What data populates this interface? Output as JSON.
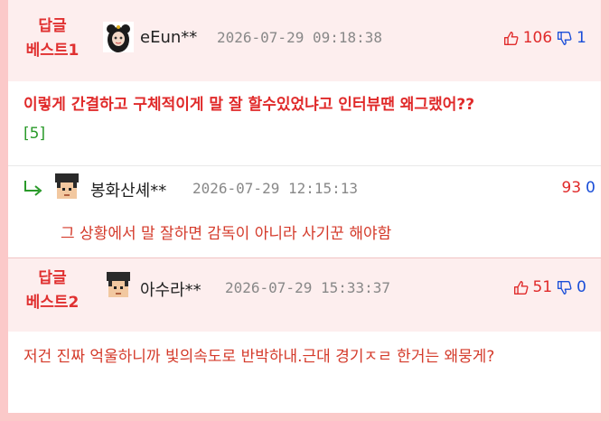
{
  "comments": [
    {
      "badge_line1": "답글",
      "badge_line2": "베스트1",
      "nickname": "eEun**",
      "date": "2026-07-29 09:18:38",
      "up": "106",
      "down": "1",
      "text": "이렇게 간결하고 구체적이게 말 잘 할수있었냐고 인터뷰땐 왜그랬어??",
      "reply_count": "[5]"
    },
    {
      "badge_line1": "답글",
      "badge_line2": "베스트2",
      "nickname": "아수라**",
      "date": "2026-07-29 15:33:37",
      "up": "51",
      "down": "0",
      "text": "저건 진짜 억울하니까 빛의속도로 반박하내.근대 경기ㅈㄹ 한거는 왜뭉게?"
    }
  ],
  "reply": {
    "nickname": "봉화산셰**",
    "date": "2026-07-29 12:15:13",
    "up": "93",
    "down": "0",
    "text": "그 상황에서 말 잘하면 감독이 아니라 사기꾼 해야함"
  },
  "colors": {
    "accent": "#e02a2a",
    "down": "#1a4ed8",
    "header_bg": "#fdeeee",
    "border": "#fbc9c9"
  },
  "icons": [
    "thumbs-up-icon",
    "thumbs-down-icon",
    "reply-arrow-icon",
    "avatar"
  ]
}
